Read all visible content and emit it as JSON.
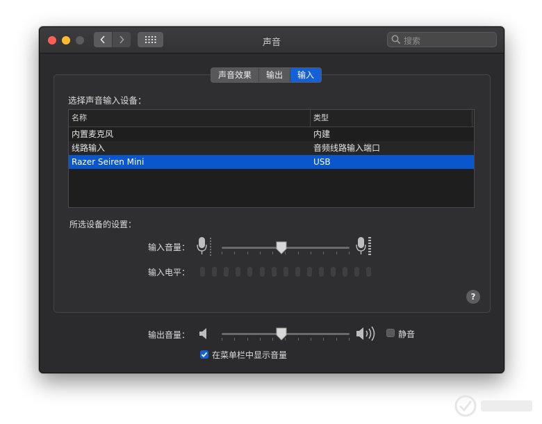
{
  "window": {
    "title": "声音",
    "search_placeholder": "搜索"
  },
  "tabs": [
    {
      "label": "声音效果",
      "active": false
    },
    {
      "label": "输出",
      "active": false
    },
    {
      "label": "输入",
      "active": true
    }
  ],
  "input": {
    "section_title": "选择声音输入设备：",
    "table": {
      "headers": [
        "名称",
        "类型"
      ],
      "rows": [
        {
          "name": "内置麦克风",
          "type": "内建",
          "selected": false
        },
        {
          "name": "线路输入",
          "type": "音频线路输入端口",
          "selected": false
        },
        {
          "name": "Razer Seiren Mini",
          "type": "USB",
          "selected": true
        }
      ]
    },
    "settings_title": "所选设备的设置：",
    "volume_label": "输入音量：",
    "volume_level": 0.47,
    "level_label": "输入电平：",
    "level_segments": 15,
    "level_active": 0
  },
  "output": {
    "volume_label": "输出音量：",
    "volume_level": 0.47,
    "mute_label": "静音",
    "mute_checked": false,
    "show_in_menubar_label": "在菜单栏中显示音量",
    "show_in_menubar_checked": true
  },
  "help": "?",
  "colors": {
    "accent": "#1560d6",
    "selection": "#0a56cc",
    "window_bg": "#2b2b2d"
  }
}
